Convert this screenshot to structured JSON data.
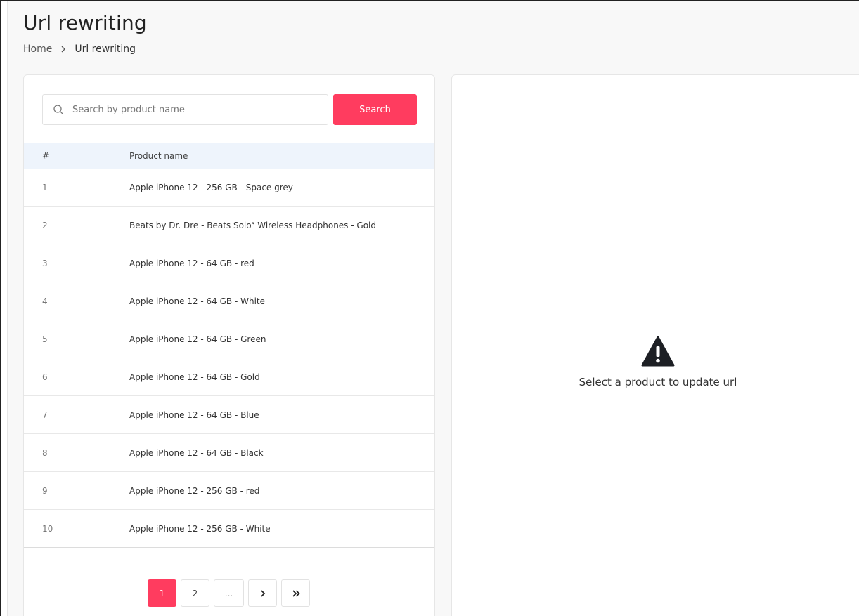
{
  "page": {
    "title": "Url rewriting"
  },
  "breadcrumb": {
    "home": "Home",
    "current": "Url rewriting"
  },
  "search": {
    "placeholder": "Search by product name",
    "value": "",
    "button_label": "Search"
  },
  "table": {
    "headers": {
      "num": "#",
      "name": "Product name"
    },
    "rows": [
      {
        "num": "1",
        "name": "Apple iPhone 12 - 256 GB - Space grey"
      },
      {
        "num": "2",
        "name": "Beats by Dr. Dre - Beats Solo³ Wireless Headphones - Gold"
      },
      {
        "num": "3",
        "name": "Apple iPhone 12 - 64 GB - red"
      },
      {
        "num": "4",
        "name": "Apple iPhone 12 - 64 GB - White"
      },
      {
        "num": "5",
        "name": "Apple iPhone 12 - 64 GB - Green"
      },
      {
        "num": "6",
        "name": "Apple iPhone 12 - 64 GB - Gold"
      },
      {
        "num": "7",
        "name": "Apple iPhone 12 - 64 GB - Blue"
      },
      {
        "num": "8",
        "name": "Apple iPhone 12 - 64 GB - Black"
      },
      {
        "num": "9",
        "name": "Apple iPhone 12 - 256 GB - red"
      },
      {
        "num": "10",
        "name": "Apple iPhone 12 - 256 GB - White"
      }
    ]
  },
  "pagination": {
    "page1": "1",
    "page2": "2",
    "ellipsis": "...",
    "next_icon": "chevron-right-icon",
    "last_icon": "double-chevron-right-icon",
    "current_page": 1
  },
  "empty_state": {
    "icon": "warning-icon",
    "message": "Select a product to update url"
  },
  "colors": {
    "accent": "#ff3c5f",
    "table_header_bg": "#eef4fc"
  }
}
